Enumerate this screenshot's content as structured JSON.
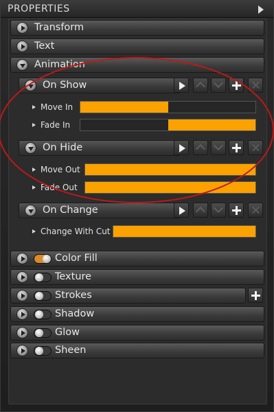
{
  "panel": {
    "title": "PROPERTIES"
  },
  "sections": {
    "transform": "Transform",
    "text": "Text",
    "animation": "Animation",
    "color_fill": "Color Fill",
    "texture": "Texture",
    "strokes": "Strokes",
    "shadow": "Shadow",
    "glow": "Glow",
    "sheen": "Sheen"
  },
  "animation": {
    "on_show": {
      "label": "On Show",
      "tracks": [
        {
          "label": "Move In",
          "fill_start": 0.0,
          "fill_end": 0.5
        },
        {
          "label": "Fade In",
          "fill_start": 0.5,
          "fill_end": 1.0
        }
      ]
    },
    "on_hide": {
      "label": "On Hide",
      "tracks": [
        {
          "label": "Move Out",
          "fill_start": 0.0,
          "fill_end": 1.0
        },
        {
          "label": "Fade Out",
          "fill_start": 0.0,
          "fill_end": 1.0
        }
      ]
    },
    "on_change": {
      "label": "On Change",
      "tracks": [
        {
          "label": "Change With Cut",
          "fill_start": 0.0,
          "fill_end": 1.0
        }
      ]
    }
  },
  "toggles": {
    "color_fill": true,
    "texture": false,
    "strokes": false,
    "shadow": false,
    "glow": false,
    "sheen": false
  },
  "colors": {
    "accent": "#fba200",
    "annotation": "#c01818"
  }
}
